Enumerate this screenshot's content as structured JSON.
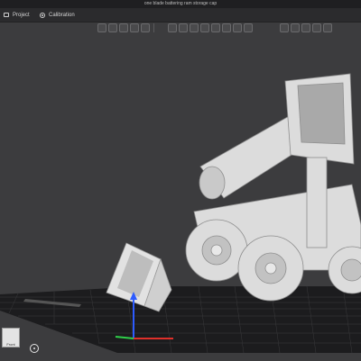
{
  "window": {
    "title": "one blade battering ram storage cap"
  },
  "tabs": [
    {
      "label": "Project",
      "icon": "home-icon"
    },
    {
      "label": "Calibration",
      "icon": "target-icon"
    }
  ],
  "view_cube": {
    "face_label": "Front"
  },
  "colors": {
    "background": "#3c3c3e",
    "model": "#d9d9d9",
    "grid": "#1a1a1a",
    "axis_x": "#e0302a",
    "axis_y": "#2fd04a",
    "axis_z": "#2d5bff"
  }
}
